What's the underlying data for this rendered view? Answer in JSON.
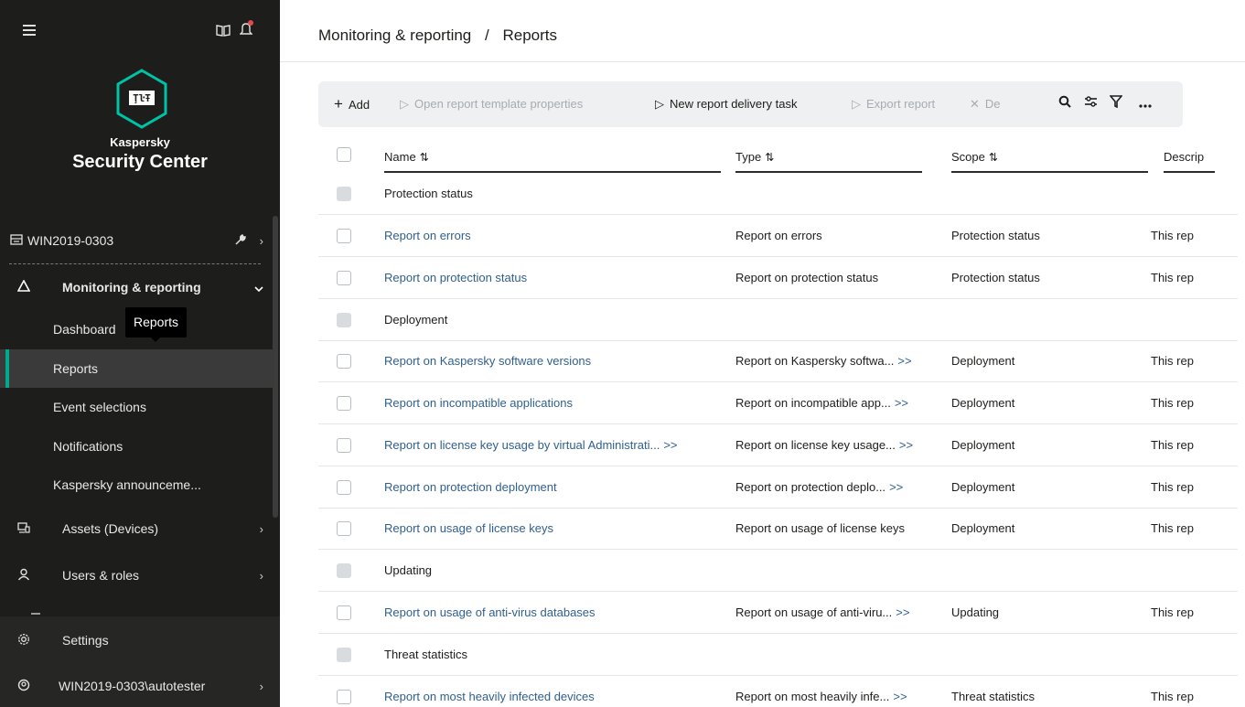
{
  "sidebar": {
    "brand_small": "Kaspersky",
    "brand_big": "Security Center",
    "device": "WIN2019-0303",
    "monitoring": "Monitoring & reporting",
    "sub_items": [
      "Dashboard",
      "Reports",
      "Event selections",
      "Notifications",
      "Kaspersky announceme..."
    ],
    "tooltip": "Reports",
    "assets": "Assets (Devices)",
    "users": "Users & roles",
    "settings": "Settings",
    "account": "WIN2019-0303\\autotester"
  },
  "breadcrumb": {
    "parent": "Monitoring & reporting",
    "separator": "/",
    "current": "Reports"
  },
  "toolbar": {
    "add": "Add",
    "open_template": "Open report template properties",
    "new_delivery": "New report delivery task",
    "export": "Export report",
    "delete": "De"
  },
  "columns": {
    "name": "Name",
    "type": "Type",
    "scope": "Scope",
    "desc": "Descrip"
  },
  "rows": [
    {
      "group": true,
      "name": "Protection status"
    },
    {
      "name": "Report on errors",
      "type": "Report on errors",
      "scope": "Protection status",
      "desc": "This rep"
    },
    {
      "name": "Report on protection status",
      "type": "Report on protection status",
      "scope": "Protection status",
      "desc": "This rep"
    },
    {
      "group": true,
      "name": "Deployment"
    },
    {
      "name": "Report on Kaspersky software versions",
      "type": "Report on Kaspersky softwa...",
      "type_more": ">>",
      "scope": "Deployment",
      "desc": "This rep"
    },
    {
      "name": "Report on incompatible applications",
      "type": "Report on incompatible app...",
      "type_more": ">>",
      "scope": "Deployment",
      "desc": "This rep"
    },
    {
      "name": "Report on license key usage by virtual Administrati...",
      "name_more": ">>",
      "type": "Report on license key usage...",
      "type_more": ">>",
      "scope": "Deployment",
      "desc": "This rep"
    },
    {
      "name": "Report on protection deployment",
      "type": "Report on protection deplo...",
      "type_more": ">>",
      "scope": "Deployment",
      "desc": "This rep"
    },
    {
      "name": "Report on usage of license keys",
      "type": "Report on usage of license keys",
      "scope": "Deployment",
      "desc": "This rep"
    },
    {
      "group": true,
      "name": "Updating"
    },
    {
      "name": "Report on usage of anti-virus databases",
      "type": "Report on usage of anti-viru...",
      "type_more": ">>",
      "scope": "Updating",
      "desc": "This rep"
    },
    {
      "group": true,
      "name": "Threat statistics"
    },
    {
      "name": "Report on most heavily infected devices",
      "type": "Report on most heavily infe...",
      "type_more": ">>",
      "scope": "Threat statistics",
      "desc": "This rep"
    }
  ],
  "colors": {
    "sidebar_bg": "#1d1d1b",
    "accent": "#00a88e",
    "link": "#2f5f8f",
    "toolbar_bg": "#eef0f2"
  },
  "icons": [
    "menu-icon",
    "book-icon",
    "bell-icon",
    "kaspersky-logo-icon",
    "server-icon",
    "wrench-icon",
    "warning-icon",
    "assets-icon",
    "users-icon",
    "gear-icon",
    "account-icon",
    "plus-icon",
    "play-icon",
    "search-icon",
    "settings-sliders-icon",
    "filter-icon",
    "more-icon",
    "sort-icon"
  ]
}
